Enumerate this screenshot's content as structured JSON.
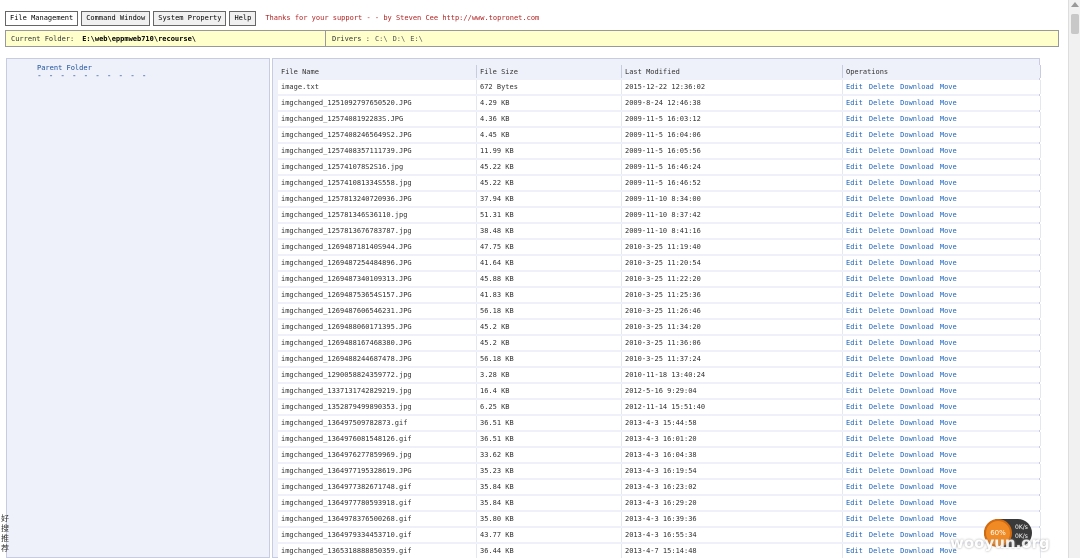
{
  "menu": {
    "buttons": [
      "File Management",
      "Command Window",
      "System Property",
      "Help"
    ],
    "thanks": "Thanks for your support - - by Steven Cee http://www.topronet.com"
  },
  "folder": {
    "label": "Current Folder:",
    "path": "E:\\web\\eppmweb710\\recourse\\",
    "drivers_label": "Drivers :",
    "drives": [
      "C:\\",
      "D:\\",
      "E:\\"
    ]
  },
  "sidebar": {
    "parent_folder": "Parent Folder",
    "dashes": "- - - - - - - - - -"
  },
  "table": {
    "headers": [
      "File Name",
      "File Size",
      "Last Modified",
      "Operations"
    ],
    "ops": [
      "Edit",
      "Delete",
      "Download",
      "Move"
    ],
    "rows": [
      [
        "image.txt",
        "672 Bytes",
        "2015-12-22 12:36:02"
      ],
      [
        "imgchanged_1251092797650520.JPG",
        "4.29 KB",
        "2009-8-24 12:46:38"
      ],
      [
        "imgchanged_1257408192283S.JPG",
        "4.36 KB",
        "2009-11-5 16:03:12"
      ],
      [
        "imgchanged_12574082465649S2.JPG",
        "4.45 KB",
        "2009-11-5 16:04:06"
      ],
      [
        "imgchanged_1257408357111739.JPG",
        "11.99 KB",
        "2009-11-5 16:05:56"
      ],
      [
        "imgchanged_125741078S2S16.jpg",
        "45.22 KB",
        "2009-11-5 16:46:24"
      ],
      [
        "imgchanged_125741081334S558.jpg",
        "45.22 KB",
        "2009-11-5 16:46:52"
      ],
      [
        "imgchanged_1257813240720936.JPG",
        "37.94 KB",
        "2009-11-10 8:34:00"
      ],
      [
        "imgchanged_125781346S36110.jpg",
        "51.31 KB",
        "2009-11-10 8:37:42"
      ],
      [
        "imgchanged_1257813676783787.jpg",
        "38.48 KB",
        "2009-11-10 8:41:16"
      ],
      [
        "imgchanged_126948718140S944.JPG",
        "47.75 KB",
        "2010-3-25 11:19:40"
      ],
      [
        "imgchanged_1269487254484896.JPG",
        "41.64 KB",
        "2010-3-25 11:20:54"
      ],
      [
        "imgchanged_1269487340109313.JPG",
        "45.88 KB",
        "2010-3-25 11:22:20"
      ],
      [
        "imgchanged_126948753654S157.JPG",
        "41.83 KB",
        "2010-3-25 11:25:36"
      ],
      [
        "imgchanged_1269487606546231.JPG",
        "56.18 KB",
        "2010-3-25 11:26:46"
      ],
      [
        "imgchanged_1269488060171395.JPG",
        "45.2 KB",
        "2010-3-25 11:34:20"
      ],
      [
        "imgchanged_1269488167468380.JPG",
        "45.2 KB",
        "2010-3-25 11:36:06"
      ],
      [
        "imgchanged_1269488244687478.JPG",
        "56.18 KB",
        "2010-3-25 11:37:24"
      ],
      [
        "imgchanged_1290058824359772.jpg",
        "3.28 KB",
        "2010-11-18 13:40:24"
      ],
      [
        "imgchanged_1337131742829219.jpg",
        "16.4 KB",
        "2012-5-16 9:29:04"
      ],
      [
        "imgchanged_1352879499890353.jpg",
        "6.25 KB",
        "2012-11-14 15:51:40"
      ],
      [
        "imgchanged_136497509782873.gif",
        "36.51 KB",
        "2013-4-3 15:44:58"
      ],
      [
        "imgchanged_1364976081548126.gif",
        "36.51 KB",
        "2013-4-3 16:01:20"
      ],
      [
        "imgchanged_1364976277859969.jpg",
        "33.62 KB",
        "2013-4-3 16:04:38"
      ],
      [
        "imgchanged_1364977195328619.JPG",
        "35.23 KB",
        "2013-4-3 16:19:54"
      ],
      [
        "imgchanged_1364977382671748.gif",
        "35.84 KB",
        "2013-4-3 16:23:02"
      ],
      [
        "imgchanged_1364977780593918.gif",
        "35.84 KB",
        "2013-4-3 16:29:20"
      ],
      [
        "imgchanged_1364978376500268.gif",
        "35.80 KB",
        "2013-4-3 16:39:36"
      ],
      [
        "imgchanged_1364979334453710.gif",
        "43.77 KB",
        "2013-4-3 16:55:34"
      ],
      [
        "imgchanged_1365318888850359.gif",
        "36.44 KB",
        "2013-4-7 15:14:48"
      ]
    ]
  },
  "overlay": {
    "side_text": "好搜推荐",
    "speed_percent": "60%",
    "speed_rate": "0K/s",
    "speed_rate2": "0K/s",
    "watermark": "wooyun.org"
  },
  "colors": {
    "accent_link": "#2266bb",
    "folder_bar": "#ffffcc",
    "panel_bg": "#eef0fa",
    "thanks_text": "#b22222"
  }
}
